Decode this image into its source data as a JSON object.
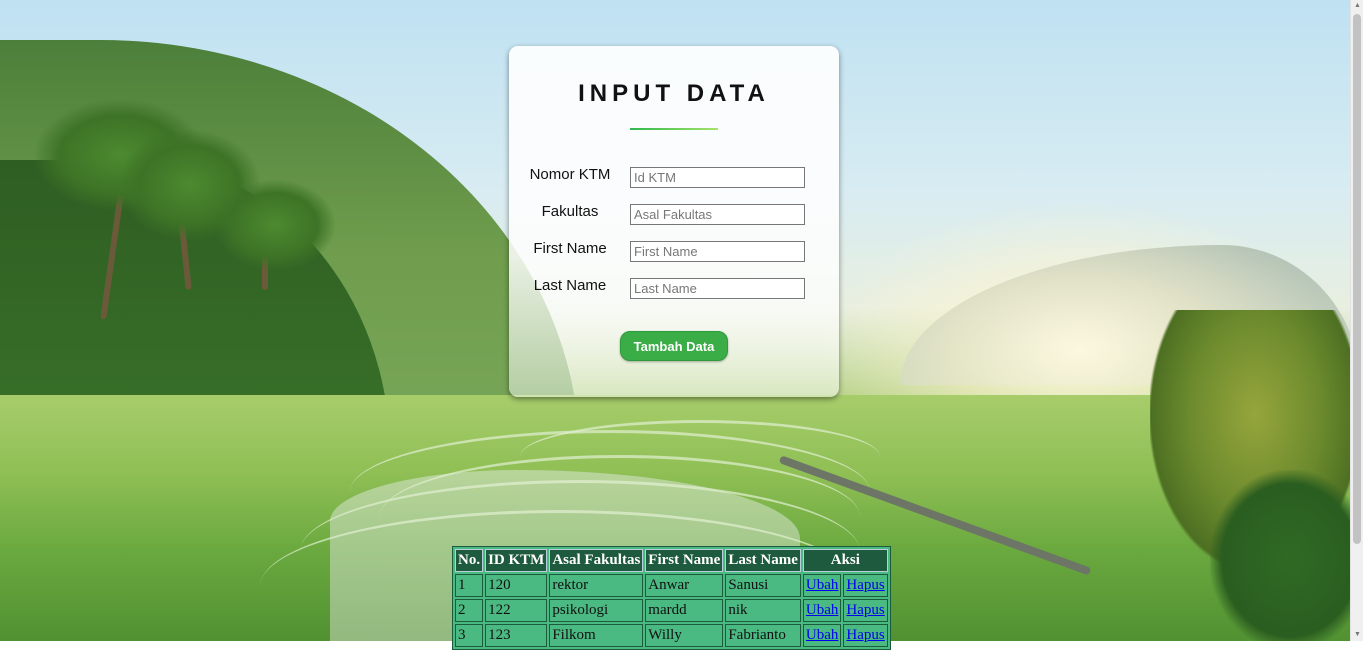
{
  "form": {
    "title": "INPUT DATA",
    "fields": [
      {
        "label": "Nomor KTM",
        "placeholder": "Id KTM",
        "value": ""
      },
      {
        "label": "Fakultas",
        "placeholder": "Asal Fakultas",
        "value": ""
      },
      {
        "label": "First Name",
        "placeholder": "First Name",
        "value": ""
      },
      {
        "label": "Last Name",
        "placeholder": "Last Name",
        "value": ""
      }
    ],
    "submit_label": "Tambah Data"
  },
  "table": {
    "headers": [
      "No.",
      "ID KTM",
      "Asal Fakultas",
      "First Name",
      "Last Name",
      "Aksi"
    ],
    "rows": [
      {
        "no": "1",
        "id": "120",
        "fakultas": "rektor",
        "first": "Anwar",
        "last": "Sanusi",
        "edit": "Ubah",
        "delete": "Hapus"
      },
      {
        "no": "2",
        "id": "122",
        "fakultas": "psikologi",
        "first": "mardd",
        "last": "nik",
        "edit": "Ubah",
        "delete": "Hapus"
      },
      {
        "no": "3",
        "id": "123",
        "fakultas": "Filkom",
        "first": "Willy",
        "last": "Fabrianto",
        "edit": "Ubah",
        "delete": "Hapus"
      }
    ]
  },
  "colors": {
    "accent": "#3aad47",
    "table_header": "#1e5a3e",
    "table_cell": "#4ab982",
    "link": "#0000ee"
  },
  "icons": {
    "background": "landscape-background-image",
    "scroll_up": "triangle-up-icon",
    "scroll_down": "triangle-down-icon"
  }
}
